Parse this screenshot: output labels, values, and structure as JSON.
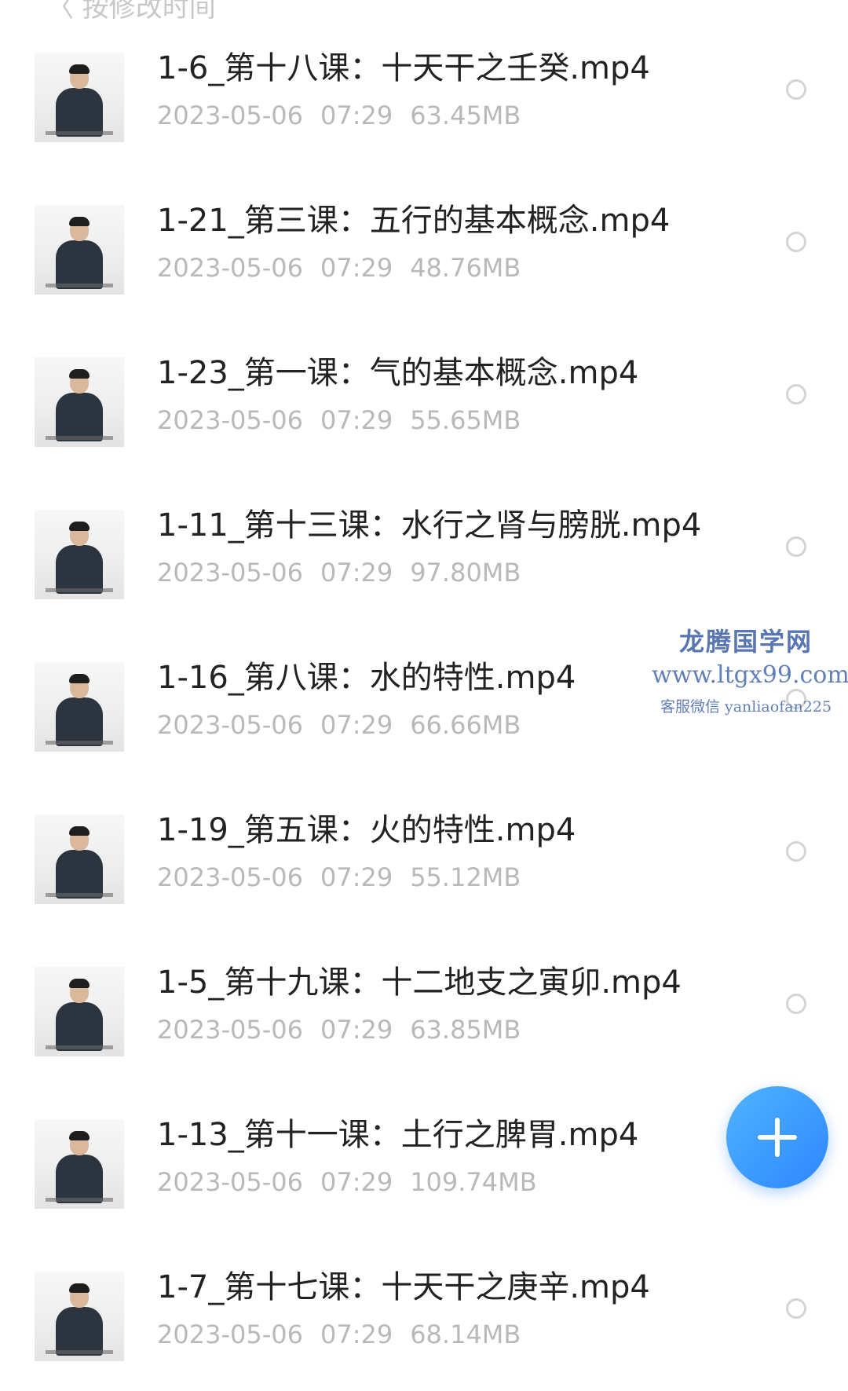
{
  "header": {
    "partial_text": "〈 按修改时间"
  },
  "files": [
    {
      "name": "1-6_第十八课：十天干之壬癸.mp4",
      "date": "2023-05-06",
      "time": "07:29",
      "size": "63.45MB",
      "thumb_icon": "video-thumbnail"
    },
    {
      "name": "1-21_第三课：五行的基本概念.mp4",
      "date": "2023-05-06",
      "time": "07:29",
      "size": "48.76MB",
      "thumb_icon": "video-thumbnail"
    },
    {
      "name": "1-23_第一课：气的基本概念.mp4",
      "date": "2023-05-06",
      "time": "07:29",
      "size": "55.65MB",
      "thumb_icon": "video-thumbnail"
    },
    {
      "name": "1-11_第十三课：水行之肾与膀胱.mp4",
      "date": "2023-05-06",
      "time": "07:29",
      "size": "97.80MB",
      "thumb_icon": "video-thumbnail"
    },
    {
      "name": "1-16_第八课：水的特性.mp4",
      "date": "2023-05-06",
      "time": "07:29",
      "size": "66.66MB",
      "thumb_icon": "video-thumbnail"
    },
    {
      "name": "1-19_第五课：火的特性.mp4",
      "date": "2023-05-06",
      "time": "07:29",
      "size": "55.12MB",
      "thumb_icon": "video-thumbnail"
    },
    {
      "name": "1-5_第十九课：十二地支之寅卯.mp4",
      "date": "2023-05-06",
      "time": "07:29",
      "size": "63.85MB",
      "thumb_icon": "video-thumbnail"
    },
    {
      "name": "1-13_第十一课：土行之脾胃.mp4",
      "date": "2023-05-06",
      "time": "07:29",
      "size": "109.74MB",
      "thumb_icon": "video-thumbnail"
    },
    {
      "name": "1-7_第十七课：十天干之庚辛.mp4",
      "date": "2023-05-06",
      "time": "07:29",
      "size": "68.14MB",
      "thumb_icon": "video-thumbnail"
    }
  ],
  "fab": {
    "icon": "plus-icon",
    "color_start": "#4fb4ff",
    "color_end": "#2e86ff"
  },
  "watermark": {
    "title": "龙腾国学网",
    "url": "www.ltgx99.com",
    "contact": "客服微信 yanliaofan225"
  },
  "colors": {
    "name_text": "#222222",
    "meta_text": "#b9b9b9",
    "radio_border": "#d4d4d4",
    "watermark": "#3c5ea8"
  }
}
